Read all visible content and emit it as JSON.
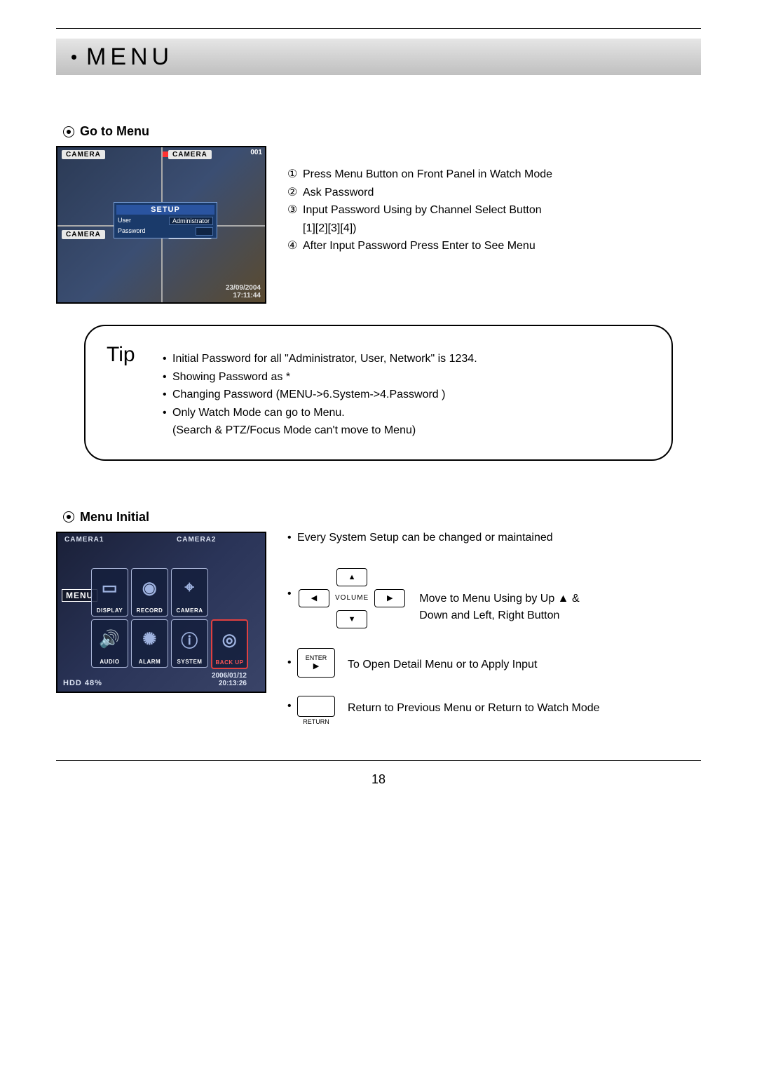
{
  "title": "MENU",
  "section1": {
    "title": "Go to Menu",
    "screenshot": {
      "cam_label": "CAMERA",
      "counter": "001",
      "setup_title": "SETUP",
      "user_label": "User",
      "user_value": "Administrator",
      "pass_label": "Password",
      "date": "23/09/2004",
      "time": "17:11:44"
    },
    "steps": {
      "s1_num": "①",
      "s1": "Press Menu Button on Front Panel in Watch Mode",
      "s2_num": "②",
      "s2": "Ask Password",
      "s3_num": "③",
      "s3": "Input Password Using by Channel Select Button",
      "s3b": "[1][2][3][4])",
      "s4_num": "④",
      "s4": "After Input Password Press Enter to See Menu"
    }
  },
  "tip": {
    "label": "Tip",
    "t1": "Initial Password for all \"Administrator, User, Network\" is 1234.",
    "t2": "Showing Password as *",
    "t3": "Changing Password (MENU->6.System->4.Password )",
    "t4": "Only Watch Mode can go to Menu.",
    "t4b": "(Search & PTZ/Focus Mode can't move to Menu)"
  },
  "section2": {
    "title": "Menu Initial",
    "screenshot": {
      "cam1": "CAMERA1",
      "cam2": "CAMERA2",
      "menu_label": "MENU",
      "hdd": "HDD 48%",
      "date": "2006/01/12",
      "time": "20:13:26",
      "icons": {
        "display": "DISPLAY",
        "record": "RECORD",
        "camera": "CAMERA",
        "audio": "AUDIO",
        "alarm": "ALARM",
        "system": "SYSTEM",
        "backup": "BACK UP"
      }
    },
    "intro": "Every System Setup can be changed or maintained",
    "nav": {
      "volume": "VOLUME",
      "move": "Move to Menu Using by Up ▲ & Down and Left, Right Button",
      "enter_label": "ENTER",
      "enter_desc": "To Open Detail Menu or to Apply Input",
      "return_label": "RETURN",
      "return_desc": "Return to Previous Menu or Return to Watch Mode"
    }
  },
  "page_number": "18"
}
